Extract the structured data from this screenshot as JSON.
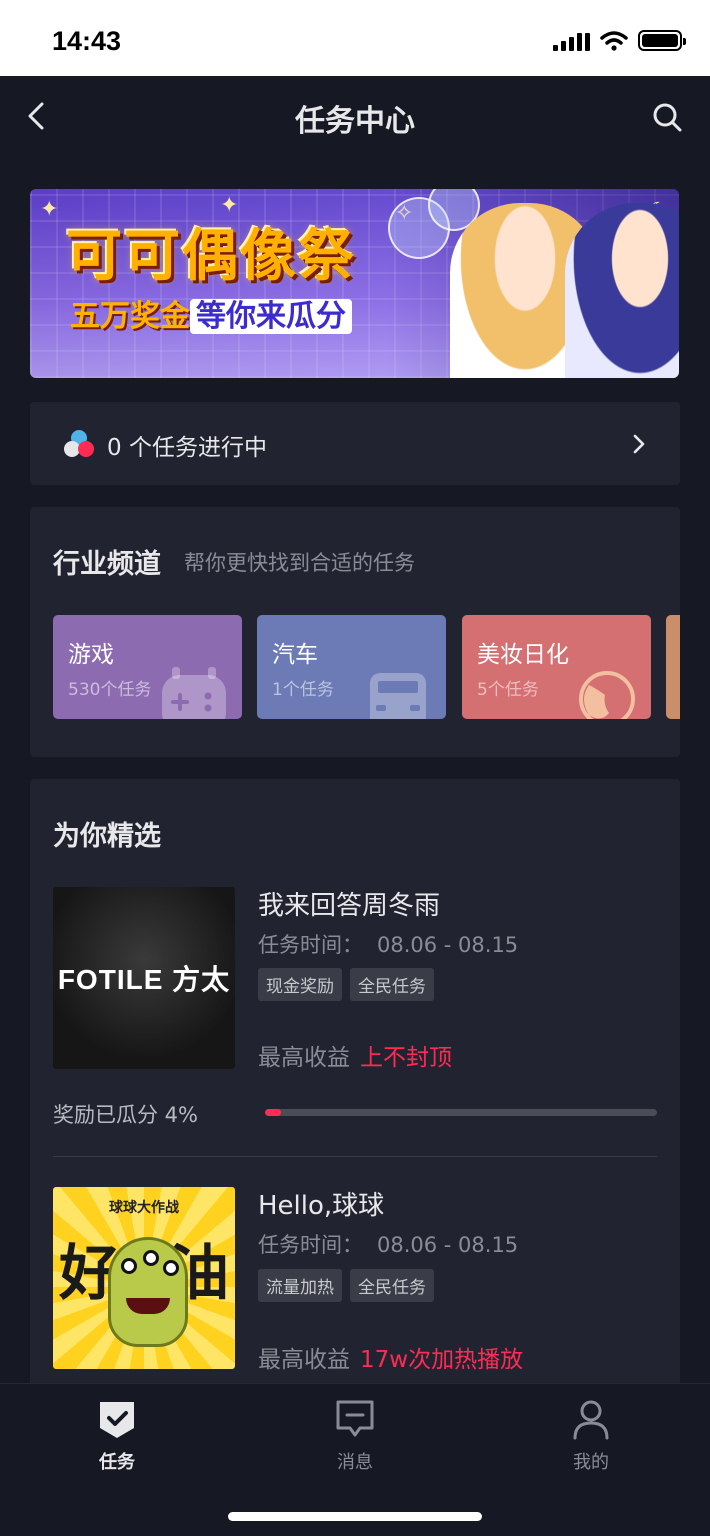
{
  "status_bar": {
    "time": "14:43"
  },
  "nav": {
    "title": "任务中心"
  },
  "banner": {
    "title": "可可偶像祭",
    "subtitle_highlight": "五万奖金",
    "subtitle_rest": "等你来瓜分"
  },
  "ongoing": {
    "text": "0 个任务进行中"
  },
  "industry": {
    "title": "行业频道",
    "subtitle": "帮你更快找到合适的任务",
    "channels": [
      {
        "name": "游戏",
        "count": "530个任务",
        "icon": "gamepad-icon"
      },
      {
        "name": "汽车",
        "count": "1个任务",
        "icon": "car-icon"
      },
      {
        "name": "美妆日化",
        "count": "5个任务",
        "icon": "face-icon"
      }
    ]
  },
  "featured": {
    "title": "为你精选",
    "tasks": [
      {
        "thumb_text": "FOTILE 方太",
        "title": "我来回答周冬雨",
        "time_label": "任务时间：",
        "time_range": "08.06 - 08.15",
        "tags": [
          "现金奖励",
          "全民任务"
        ],
        "reward_label": "最高收益",
        "reward_value": "上不封顶",
        "progress_label": "奖励已瓜分 4%",
        "progress": 0.04
      },
      {
        "thumb_top_text": "球球大作战",
        "thumb_big_left": "好",
        "thumb_big_right": "油",
        "title": "Hello,球球",
        "time_label": "任务时间：",
        "time_range": "08.06 - 08.15",
        "tags": [
          "流量加热",
          "全民任务"
        ],
        "reward_label": "最高收益",
        "reward_value": "17w次加热播放"
      }
    ]
  },
  "tab_bar": {
    "tabs": [
      {
        "label": "任务",
        "icon": "task-shield-icon",
        "active": true
      },
      {
        "label": "消息",
        "icon": "message-icon",
        "active": false
      },
      {
        "label": "我的",
        "icon": "profile-icon",
        "active": false
      }
    ]
  },
  "colors": {
    "background": "#161823",
    "card": "#212430",
    "accent": "#fe2c55"
  }
}
